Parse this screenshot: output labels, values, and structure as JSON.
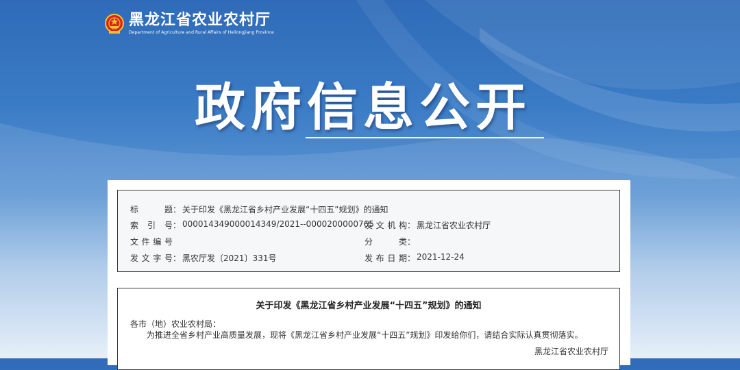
{
  "header": {
    "org_name_cn": "黑龙江省农业农村厅",
    "org_name_en": "Department of Agriculture and Rural Affairs of Heilongjiang Province"
  },
  "hero": {
    "title": "政府信息公开"
  },
  "meta": {
    "title_label": "标　　题",
    "title_value": "关于印发《黑龙江省乡村产业发展“十四五”规划》的通知",
    "index_label": "索 引 号",
    "index_value": "000014349000014349/2021--0000200000765",
    "issuer_label": "发文机构",
    "issuer_value": "黑龙江省农业农村厅",
    "docno_label": "文件编号",
    "docno_value": "",
    "category_label": "分　　类",
    "category_value": "",
    "ref_label": "发文字号",
    "ref_value": "黑农厅发〔2021〕331号",
    "date_label": "发布日期",
    "date_value": "2021-12-24"
  },
  "document": {
    "title": "关于印发《黑龙江省乡村产业发展“十四五”规划》的通知",
    "salutation": "各市（地）农业农村局：",
    "body": "为推进全省乡村产业高质量发展，现将《黑龙江省乡村产业发展“十四五”规划》印发给你们，请结合实际认真贯彻落实。",
    "signature": "黑龙江省农业农村厅"
  },
  "colors": {
    "banner_top": "#2f6bb8",
    "banner_bottom": "#e4eef8",
    "text": "#333333"
  }
}
